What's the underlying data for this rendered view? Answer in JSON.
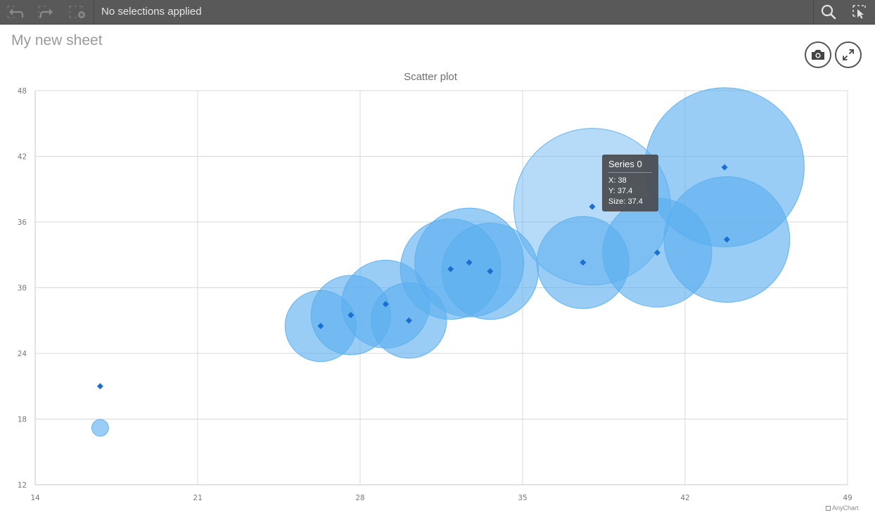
{
  "toolbar": {
    "selections_text": "No selections applied",
    "icons": [
      "undo-icon",
      "redo-icon",
      "clear-selections-icon",
      "search-icon",
      "selections-tool-icon"
    ]
  },
  "sheet": {
    "title": "My new sheet"
  },
  "actions": {
    "icons": [
      "camera-icon",
      "expand-icon"
    ]
  },
  "chart_data": {
    "type": "bubble",
    "title": "Scatter plot",
    "xlabel": "",
    "ylabel": "",
    "xlim": [
      14,
      49
    ],
    "ylim": [
      12,
      48
    ],
    "x_ticks": [
      14,
      21,
      28,
      35,
      42,
      49
    ],
    "y_ticks": [
      12,
      18,
      24,
      30,
      36,
      42,
      48
    ],
    "grid": true,
    "bubble_color": "#5aafef",
    "marker_color": "#1a6fd1",
    "series": [
      {
        "name": "Series 0",
        "points": [
          {
            "x": 16.8,
            "y": 17.2,
            "size": 4
          },
          {
            "x": 26.3,
            "y": 26.5,
            "size": 17
          },
          {
            "x": 27.6,
            "y": 27.5,
            "size": 19
          },
          {
            "x": 29.1,
            "y": 28.5,
            "size": 21
          },
          {
            "x": 30.1,
            "y": 27.0,
            "size": 18
          },
          {
            "x": 31.9,
            "y": 31.7,
            "size": 24
          },
          {
            "x": 32.7,
            "y": 32.3,
            "size": 26
          },
          {
            "x": 33.6,
            "y": 31.5,
            "size": 23
          },
          {
            "x": 37.6,
            "y": 32.3,
            "size": 22
          },
          {
            "x": 38.0,
            "y": 37.4,
            "size": 37.4,
            "highlighted": true
          },
          {
            "x": 40.8,
            "y": 33.2,
            "size": 26
          },
          {
            "x": 43.8,
            "y": 34.4,
            "size": 30
          },
          {
            "x": 43.7,
            "y": 41.0,
            "size": 38
          }
        ]
      }
    ],
    "credits": "AnyChart"
  },
  "tooltip": {
    "title": "Series 0",
    "x_line": "X: 38",
    "y_line": "Y: 37.4",
    "size_line": "Size: 37.4"
  }
}
